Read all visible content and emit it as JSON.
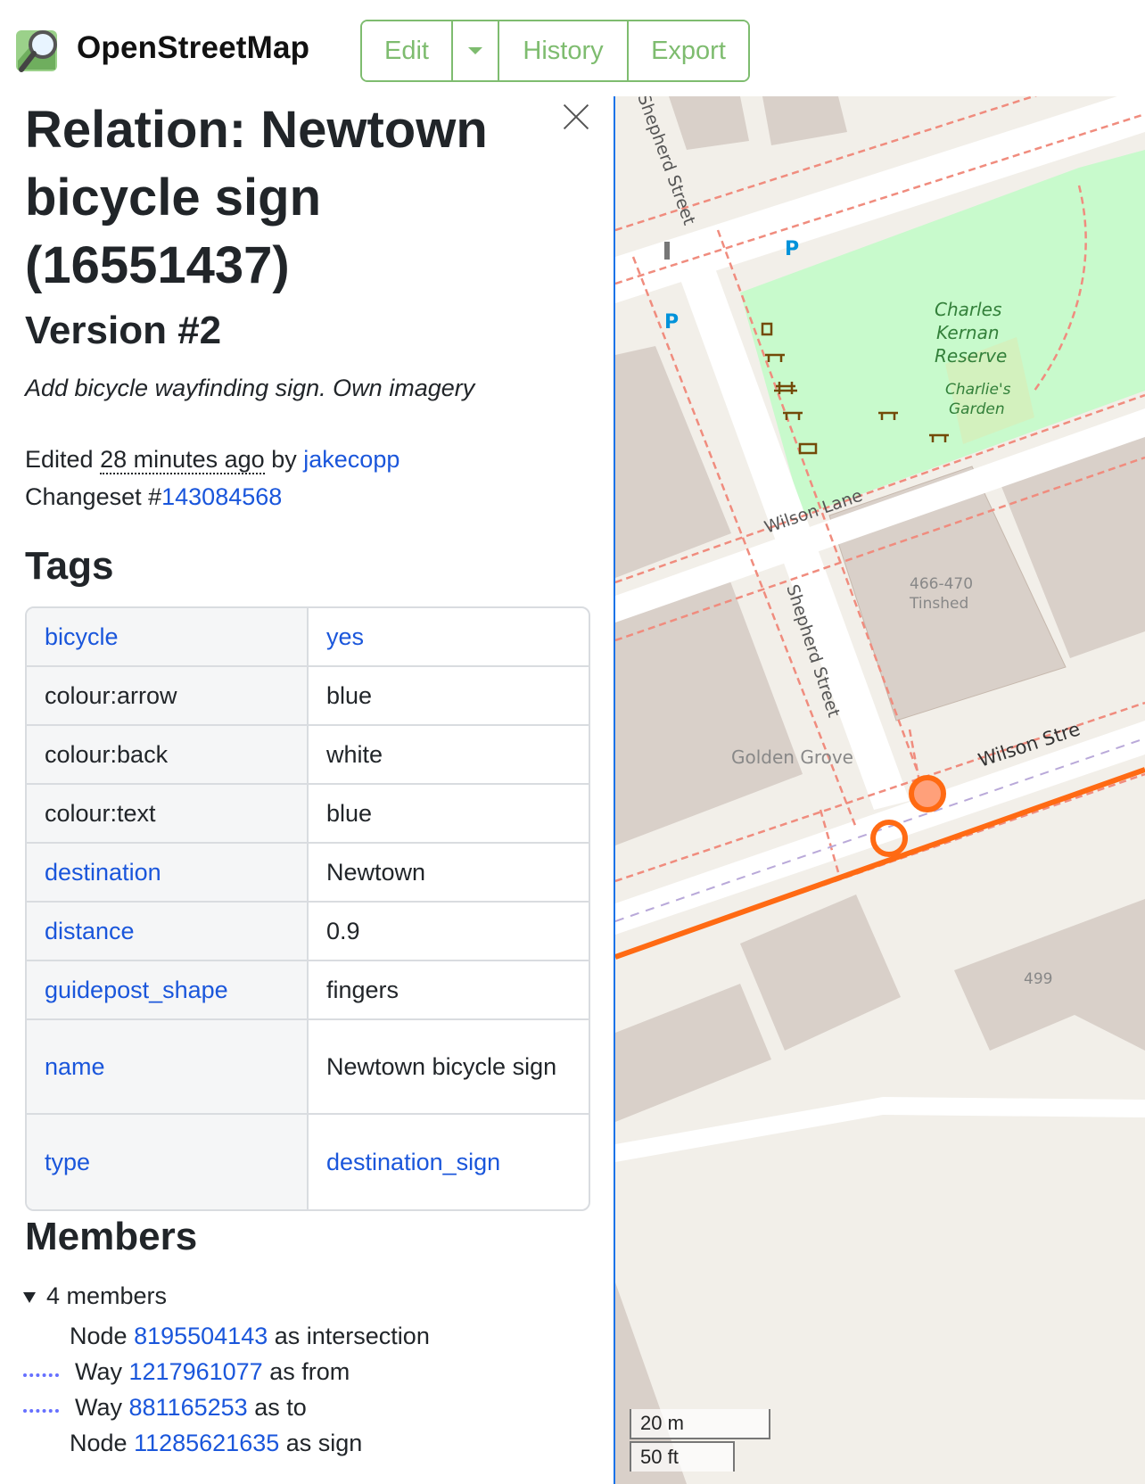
{
  "header": {
    "brand": "OpenStreetMap",
    "edit_label": "Edit",
    "history_label": "History",
    "export_label": "Export",
    "accent_color": "#7ebc6f"
  },
  "sidebar": {
    "title": "Relation: Newtown bicycle sign (16551437)",
    "version": "Version #2",
    "comment": "Add bicycle wayfinding sign. Own imagery",
    "edited_prefix": "Edited",
    "edited_time": "28 minutes ago",
    "edited_by": "by",
    "user": "jakecopp",
    "changeset_prefix": "Changeset #",
    "changeset_id": "143084568"
  },
  "tags": {
    "heading": "Tags",
    "rows": [
      {
        "key": "bicycle",
        "value": "yes",
        "key_link": true,
        "value_link": true
      },
      {
        "key": "colour:arrow",
        "value": "blue",
        "key_link": false,
        "value_link": false
      },
      {
        "key": "colour:back",
        "value": "white",
        "key_link": false,
        "value_link": false
      },
      {
        "key": "colour:text",
        "value": "blue",
        "key_link": false,
        "value_link": false
      },
      {
        "key": "destination",
        "value": "Newtown",
        "key_link": true,
        "value_link": false
      },
      {
        "key": "distance",
        "value": "0.9",
        "key_link": true,
        "value_link": false
      },
      {
        "key": "guidepost_shape",
        "value": "fingers",
        "key_link": true,
        "value_link": false
      },
      {
        "key": "name",
        "value": "Newtown bicycle sign",
        "key_link": true,
        "value_link": false
      },
      {
        "key": "type",
        "value": "destination_sign",
        "key_link": true,
        "value_link": true
      }
    ]
  },
  "members": {
    "heading": "Members",
    "summary": "4 members",
    "items": [
      {
        "type": "Node",
        "id": "8195504143",
        "role": "as intersection",
        "way_icon": false
      },
      {
        "type": "Way",
        "id": "1217961077",
        "role": "as from",
        "way_icon": true
      },
      {
        "type": "Way",
        "id": "881165253",
        "role": "as to",
        "way_icon": true
      },
      {
        "type": "Node",
        "id": "11285621635",
        "role": "as sign",
        "way_icon": false
      }
    ]
  },
  "map": {
    "labels": {
      "shepherd_street_top": "Shepherd Street",
      "shepherd_street_mid": "Shepherd Street",
      "park_name_1": "Charles",
      "park_name_2": "Kernan",
      "park_name_3": "Reserve",
      "garden_1": "Charlie's",
      "garden_2": "Garden",
      "wilson_lane": "Wilson Lane",
      "building_num_1": "466-470",
      "building_num_2": "Tinshed",
      "golden_grove": "Golden Grove",
      "wilson_street": "Wilson Stre",
      "building_499": "499"
    },
    "scale_m": "20 m",
    "scale_ft": "50 ft",
    "highlight_color": "#ff6a13",
    "park_color": "#c8facc",
    "building_color": "#d9d0c9"
  }
}
